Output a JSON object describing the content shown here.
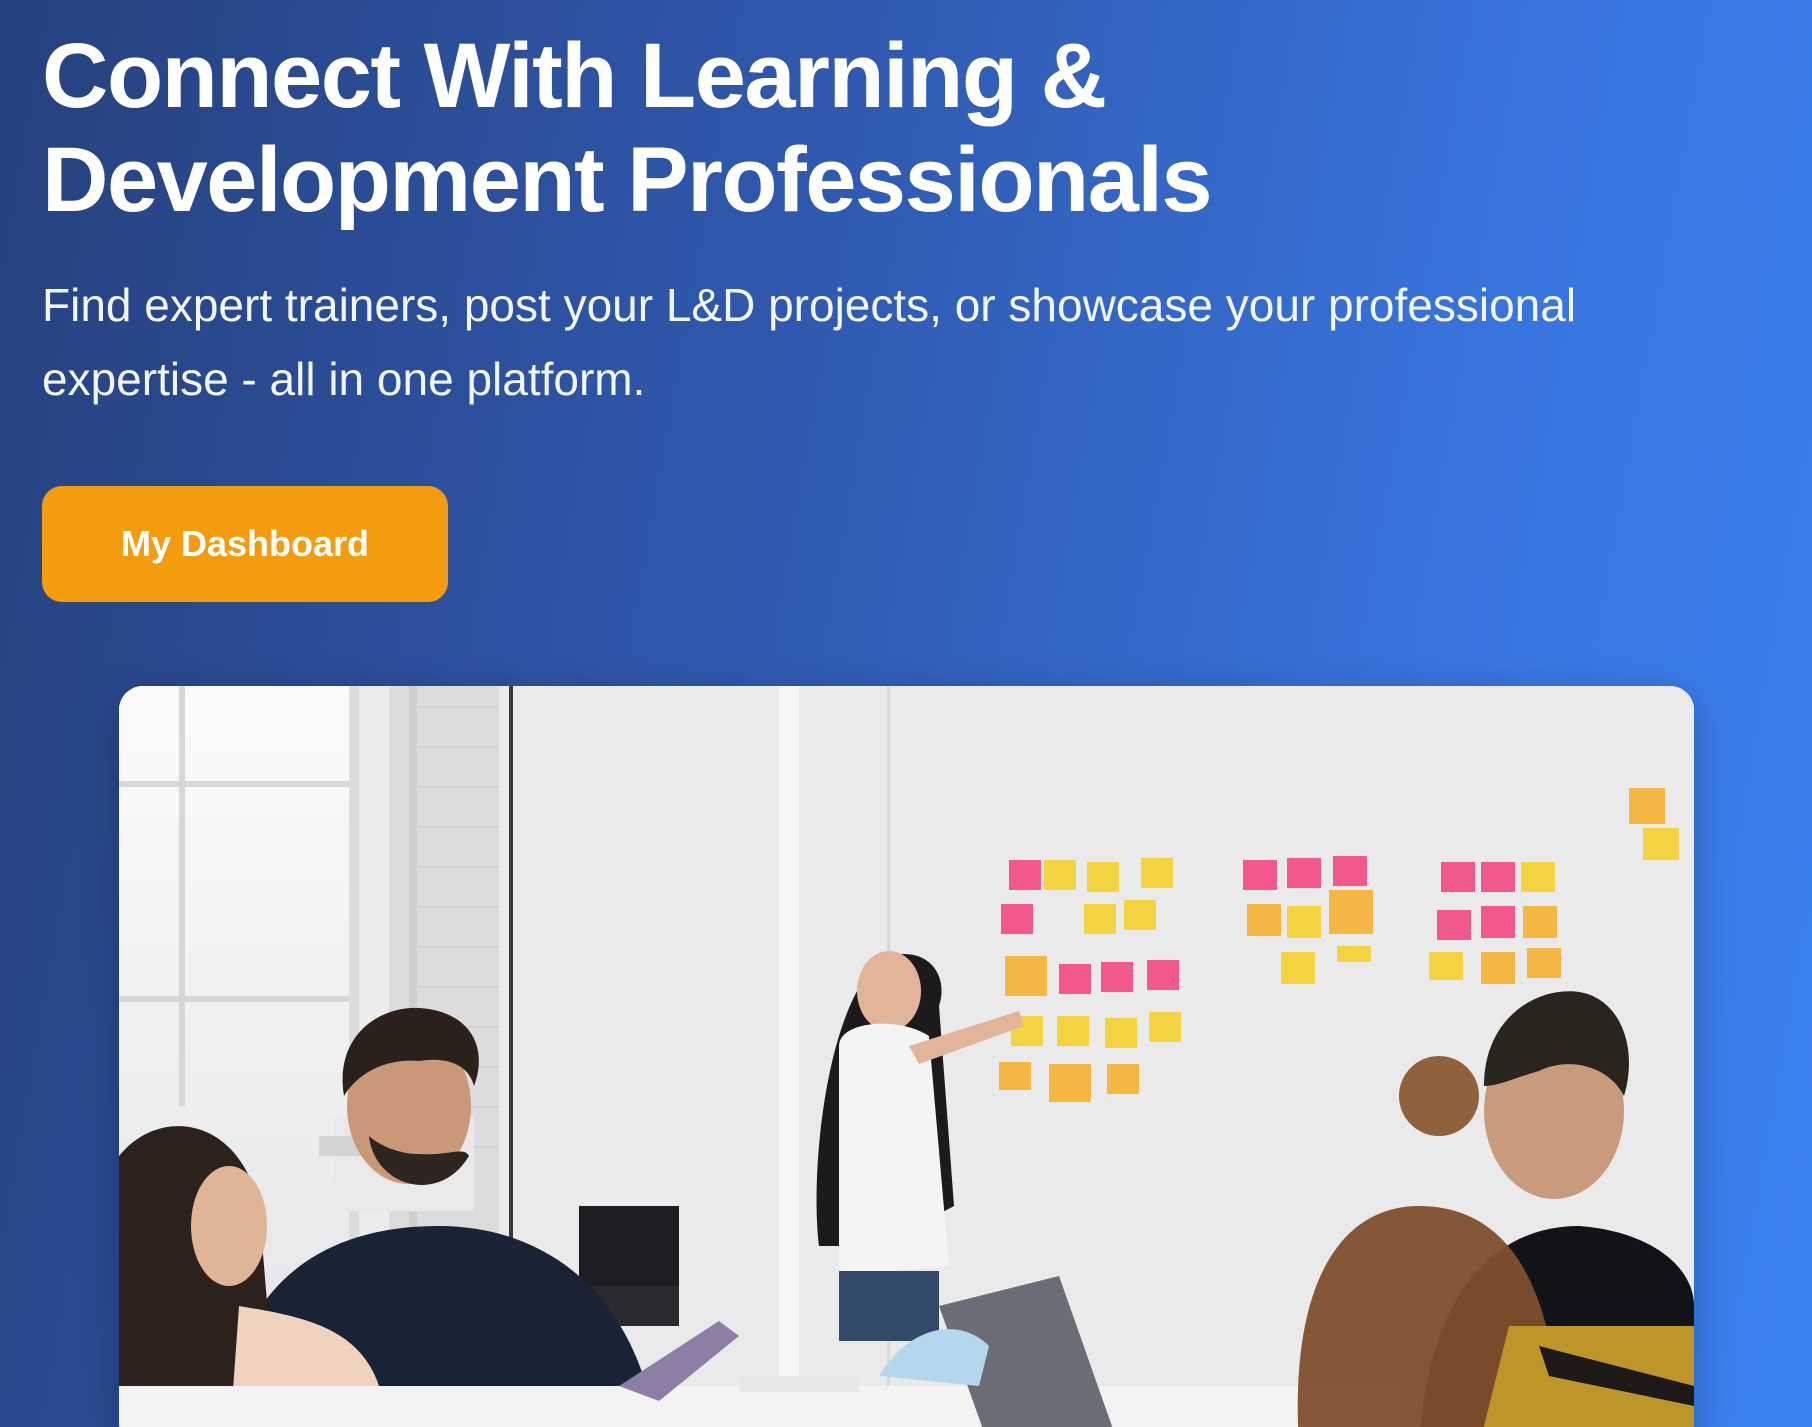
{
  "hero": {
    "title": "Connect With Learning & Development Professionals",
    "subtitle": "Find expert trainers, post your L&D projects, or showcase your professional expertise - all in one platform.",
    "cta_label": "My Dashboard",
    "image_description_icon": "team-workshop-photo"
  },
  "colors": {
    "background_start": "#26417e",
    "background_end": "#3b82f1",
    "cta": "#f39c0d",
    "text": "#ffffff"
  }
}
